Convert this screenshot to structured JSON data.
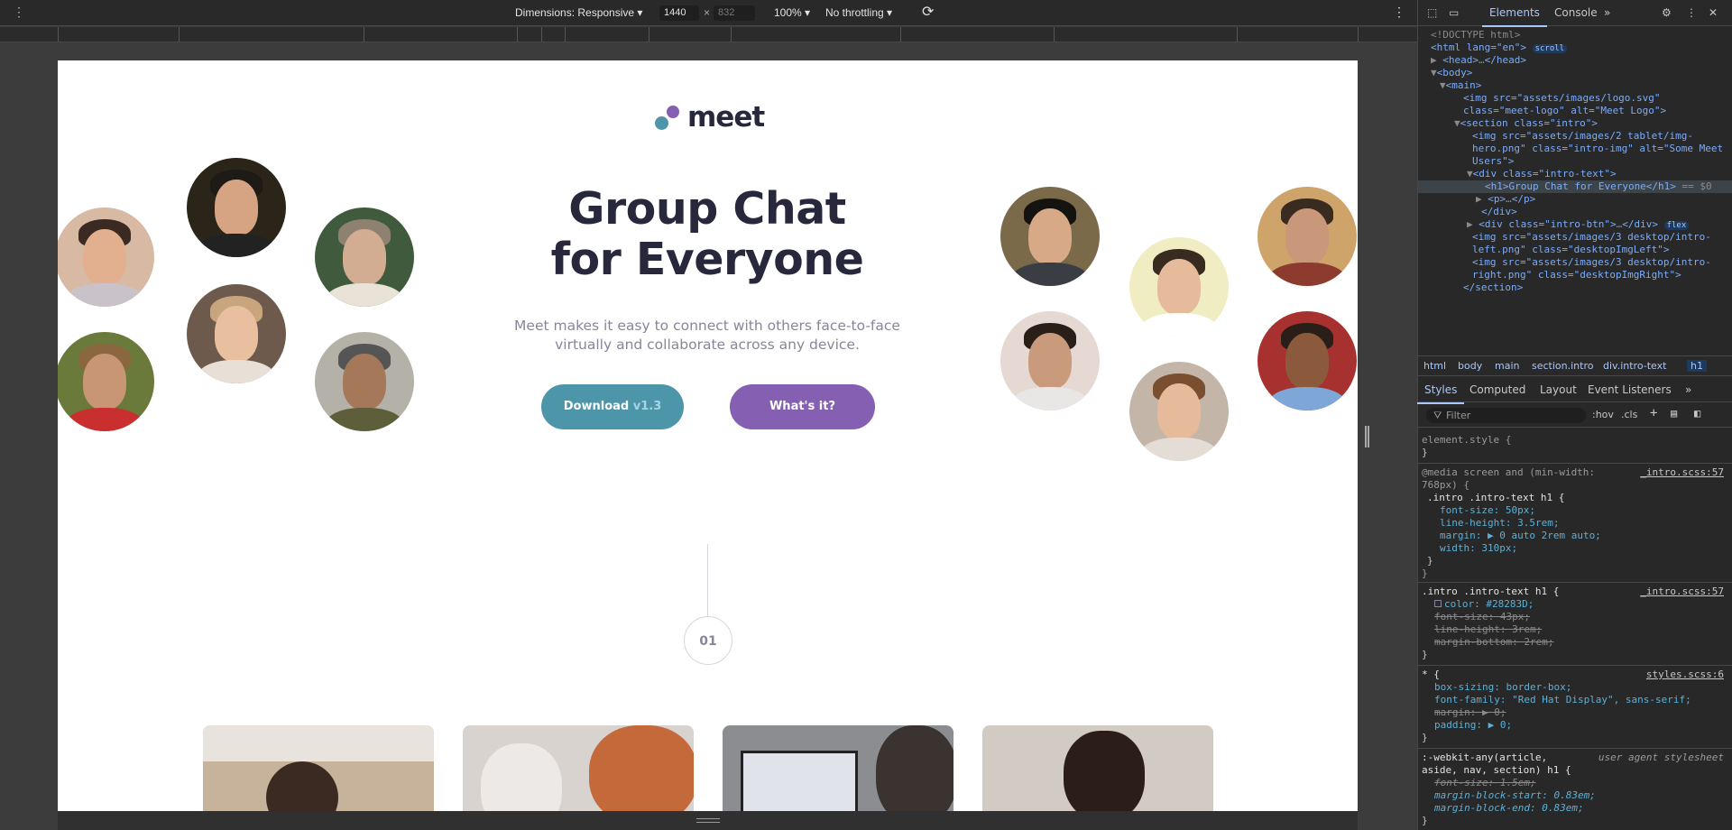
{
  "toolbar": {
    "dimensions_label": "Dimensions: Responsive",
    "width": "1440",
    "height": "832",
    "zoom": "100%",
    "throttling": "No throttling"
  },
  "page": {
    "logo_text": "meet",
    "heading_line1": "Group Chat",
    "heading_line2": "for Everyone",
    "lead": "Meet makes it easy to connect with others face-to-face virtually and collaborate across any device.",
    "download_label": "Download",
    "download_version": "v1.3",
    "whats_it_label": "What's it?",
    "step_number": "01"
  },
  "colors": {
    "heading": "#28283D",
    "teal": "#4D96A9",
    "purple": "#855FB1",
    "muted": "#87869A"
  },
  "devtools": {
    "tabs": [
      "Elements",
      "Console"
    ],
    "tree": [
      "<!DOCTYPE html>",
      "<html lang=\"en\">",
      "scroll",
      "<head>",
      "</head>",
      "<body>",
      "<main>",
      "<img src=\"assets/images/logo.svg\" class=\"meet-logo\" alt=\"Meet Logo\">",
      "<section class=\"intro\">",
      "<img src=\"assets/images/2 tablet/img-hero.png\" class=\"intro-img\" alt=\"Some Meet Users\">",
      "<div class=\"intro-text\">",
      "<h1>Group Chat for Everyone</h1>",
      "== $0",
      "<p>",
      "</p>",
      "</div>",
      "<div class=\"intro-btn\">",
      "</div>",
      "flex",
      "<img src=\"assets/images/3 desktop/intro-left.png\" class=\"desktopImgLeft\">",
      "<img src=\"assets/images/3 desktop/intro-right.png\" class=\"desktopImgRight\">",
      "</section>"
    ],
    "breadcrumbs": [
      "html",
      "body",
      "main",
      "section.intro",
      "div.intro-text",
      "h1"
    ],
    "style_tabs": [
      "Styles",
      "Computed",
      "Layout",
      "Event Listeners"
    ],
    "filter_placeholder": "Filter",
    "hov": ":hov",
    "cls": ".cls",
    "rules": {
      "element_style": "element.style {",
      "close": "}",
      "media": "@media screen and (min-width: 768px) {",
      "media_line1": "@media screen and (min-width:",
      "media_line2": "768px) {",
      "sel1": ".intro .intro-text h1 {",
      "src1": "_intro.scss:57",
      "p1": "font-size: 50px;",
      "p2": "line-height: 3.5rem;",
      "p3": "margin: ▶ 0 auto 2rem auto;",
      "p4": "width: 310px;",
      "sel2": ".intro .intro-text h1 {",
      "src2": "_intro.scss:57",
      "q1": "color: #28283D;",
      "q2": "font-size: 43px;",
      "q3": "line-height: 3rem;",
      "q4": "margin-bottom: 2rem;",
      "sel3": "* {",
      "src3": "styles.scss:6",
      "r1": "box-sizing: border-box;",
      "r2": "font-family: \"Red Hat Display\", sans-serif;",
      "r3": "margin: ▶ 0;",
      "r4": "padding: ▶ 0;",
      "sel4a": ":-webkit-any(article,",
      "sel4b": "aside, nav, section) h1 {",
      "src4": "user agent stylesheet",
      "s1": "font-size: 1.5em;",
      "s2": "margin-block-start: 0.83em;",
      "s3": "margin-block-end: 0.83em;"
    }
  }
}
